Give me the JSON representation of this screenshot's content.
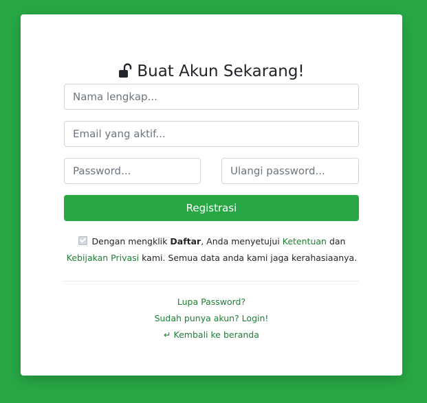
{
  "form": {
    "title": "Buat Akun Sekarang!",
    "title_icon": "unlock-icon",
    "fields": {
      "name_placeholder": "Nama lengkap...",
      "email_placeholder": "Email yang aktif...",
      "password_placeholder": "Password...",
      "repeat_password_placeholder": "Ulangi password..."
    },
    "submit_label": "Registrasi",
    "terms": {
      "checked": true,
      "prefix": "Dengan mengklik",
      "bold": "Daftar",
      "middle": ", Anda menyetujui",
      "terms_link": "Ketentuan",
      "and": "dan",
      "privacy_link": "Kebijakan Privasi",
      "suffix": "kami. Semua data anda kami jaga kerahasiaanya."
    }
  },
  "links": {
    "forgot_password": "Lupa Password?",
    "login": "Sudah punya akun? Login!",
    "back_icon": "return-arrow-icon",
    "back": "Kembali ke beranda"
  },
  "colors": {
    "page_background": "#28a745",
    "card_background": "#ffffff",
    "primary_button": "#28a745",
    "link": "#1e7e34"
  }
}
